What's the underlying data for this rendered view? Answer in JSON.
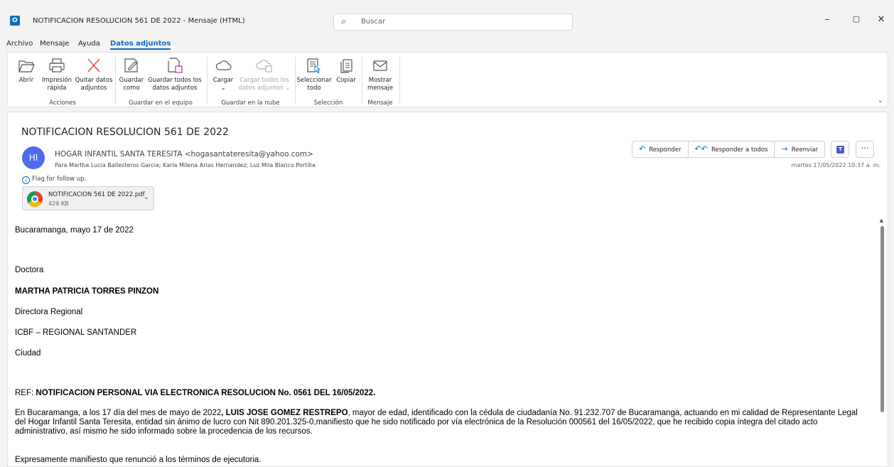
{
  "window": {
    "title": "NOTIFICACION RESOLUCION 561 DE 2022  -  Mensaje (HTML)",
    "app_icon": "O",
    "search_placeholder": "Buscar",
    "controls": {
      "minimize": "–",
      "restore": "▢",
      "close": "✕"
    }
  },
  "menu": [
    "Archivo",
    "Mensaje",
    "Ayuda",
    "Datos adjuntos"
  ],
  "ribbon": {
    "buttons": {
      "abrir": "Abrir",
      "impresion_1": "Impresión",
      "impresion_2": "rápida",
      "quitar_1": "Quitar datos",
      "quitar_2": "adjuntos",
      "guardar_1": "Guardar",
      "guardar_2": "como",
      "guardar_todos_1": "Guardar todos los",
      "guardar_todos_2": "datos adjuntos",
      "cargar_1": "Cargar",
      "cargar_2": "⌄",
      "cargar_todos_1": "Cargar todos los",
      "cargar_todos_2": "datos adjuntos ⌄",
      "seleccionar_1": "Seleccionar",
      "seleccionar_2": "todo",
      "copiar": "Copiar",
      "mostrar_1": "Mostrar",
      "mostrar_2": "mensaje"
    },
    "groups": [
      "Acciones",
      "Guardar en el equipo",
      "Guardar en la nube",
      "Selección",
      "Mensaje"
    ]
  },
  "message": {
    "subject": "NOTIFICACION RESOLUCION 561 DE 2022",
    "avatar_initials": "HI",
    "sender": "HOGAR INFANTIL SANTA TERESITA <hogasantateresita@yahoo.com>",
    "recipients": "Para    Martha Lucia Ballesteros Garcia; Karla Milena Arias Hernandez; Luz Mila Blanco Portilla",
    "flag_text": "Flag for follow up.",
    "attachment": {
      "name": "NOTIFICACION 561 DE 2022.pdf",
      "size": "429 KB"
    },
    "actions": {
      "reply": "Responder",
      "reply_all": "Responder a todos",
      "forward": "Reenviar"
    },
    "date": "martes 17/05/2022 10:37 a. m."
  },
  "body": {
    "p1": "Bucaramanga, mayo 17 de 2022",
    "p2": "Doctora",
    "p3": "MARTHA PATRICIA TORRES PINZON",
    "p4": "Directora Regional",
    "p5": "ICBF – REGIONAL SANTANDER",
    "p6": "Ciudad",
    "ref_label": "REF: ",
    "ref_text": "NOTIFICACION PERSONAL VIA ELECTRONICA RESOLUCION No. 0561 DEL 16/05/2022.",
    "para_a": "En Bucaramanga, a los 17 día del mes de mayo de 2022",
    "para_b": ", LUIS JOSE GOMEZ RESTREPO",
    "para_c": ", mayor de edad, identificado con la cédula de ciudadanía No. 91.232.707 de Bucaramanga, actuando en mi calidad de Representante Legal del Hogar Infantil Santa Teresita, entidad sin ánimo de lucro con Nit 890.201.325-0,manifiesto que he sido notificado por vía electrónica de la Resolución 000561 del 16/05/2022, que he recibido copia íntegra del citado acto administrativo, así mismo he sido informado sobre la procedencia de los recursos.",
    "p_last": "Expresamente manifiesto que renunció a los términos de ejecutoria."
  }
}
